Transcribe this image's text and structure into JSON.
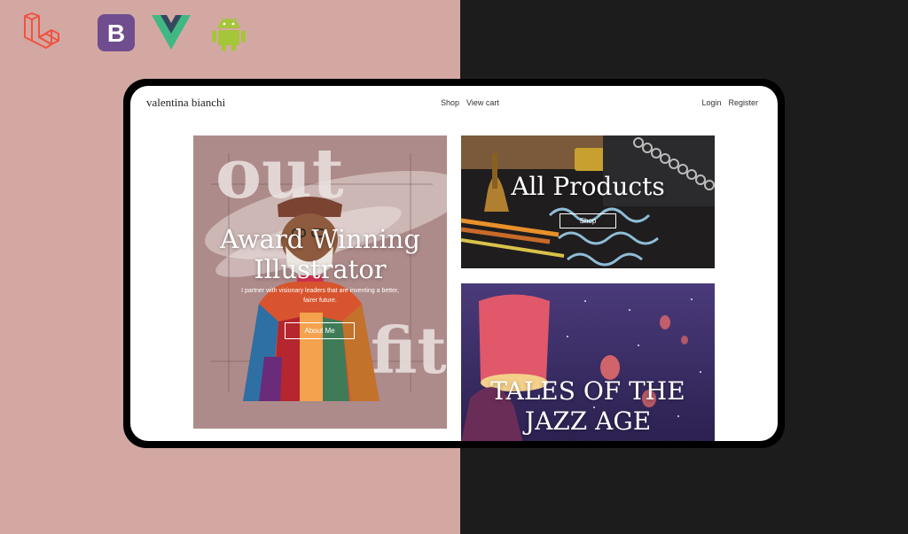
{
  "tech_icons": [
    "laravel-icon",
    "bootstrap-icon",
    "vue-icon",
    "android-icon"
  ],
  "bootstrap_letter": "B",
  "colors": {
    "bg_left": "#d3a8a3",
    "bg_right": "#1c1c1c",
    "laravel": "#f05340",
    "bootstrap": "#6f4d8e",
    "vue_green": "#41b883",
    "vue_dark": "#34495e",
    "android": "#a4c639"
  },
  "nav": {
    "brand": "valentina bianchi",
    "center_links": [
      "Shop",
      "View cart"
    ],
    "right_links": [
      "Login",
      "Register"
    ]
  },
  "hero": {
    "bg_word_1": "out",
    "bg_word_2": "fit",
    "title_line1": "Award Winning",
    "title_line2": "Illustrator",
    "subtitle_line1": "I partner with visionary leaders that are inventing a better,",
    "subtitle_line2": "fairer future.",
    "button": "About Me"
  },
  "products": {
    "title": "All Products",
    "button": "Shop",
    "lettering": "Catch some waves"
  },
  "jazz": {
    "title_line1": "TALES OF THE",
    "title_line2": "JAZZ AGE"
  }
}
